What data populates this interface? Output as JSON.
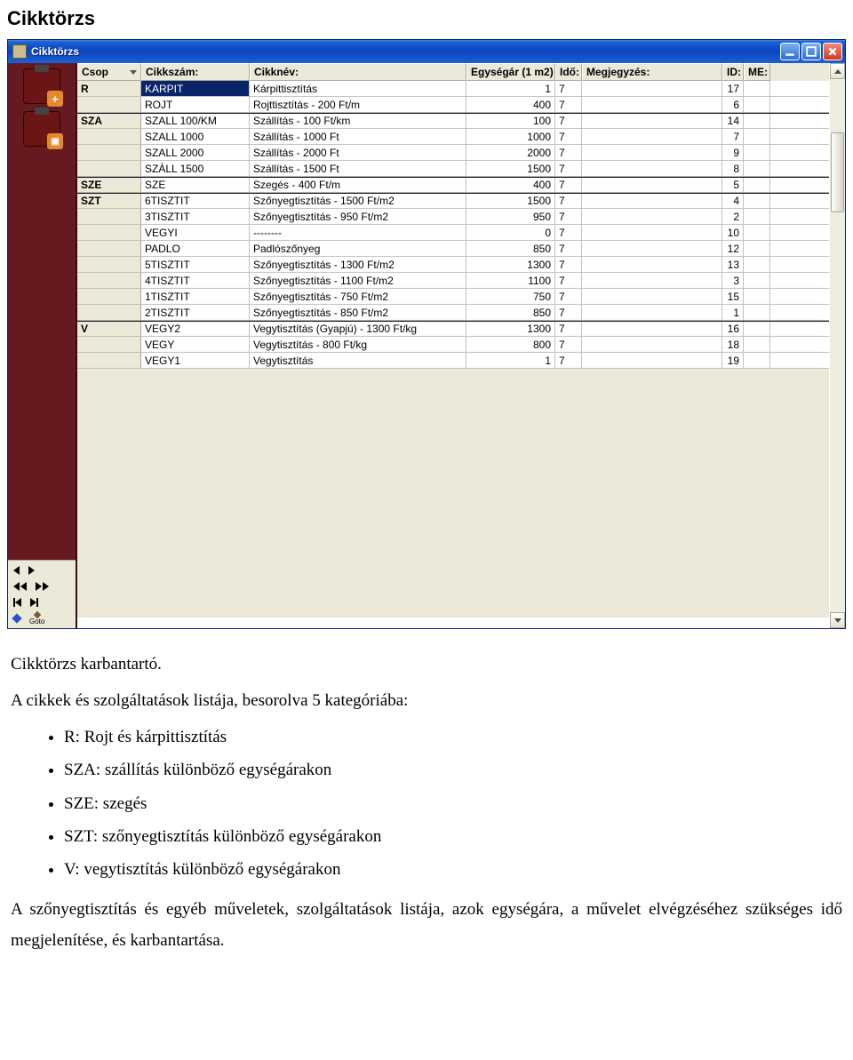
{
  "page_heading": "Cikktörzs",
  "window": {
    "title": "Cikktörzs",
    "columns": {
      "csop": "Csop",
      "cikkszam": "Cikkszám:",
      "cikknev": "Cikknév:",
      "egysegar": "Egységár (1 m2)",
      "ido": "Idő:",
      "megjegyzes": "Megjegyzés:",
      "id": "ID:",
      "me": "ME:"
    },
    "rows": [
      {
        "csop": "R",
        "sep": false,
        "szam": "KARPIT",
        "nev": "Kárpittisztítás",
        "ar": "1",
        "ido": "7",
        "megj": "",
        "id": "17",
        "me": "",
        "hl": true
      },
      {
        "csop": "",
        "sep": false,
        "szam": "ROJT",
        "nev": "Rojttisztítás - 200 Ft/m",
        "ar": "400",
        "ido": "7",
        "megj": "",
        "id": "6",
        "me": ""
      },
      {
        "csop": "SZA",
        "sep": true,
        "szam": "SZALL 100/KM",
        "nev": "Szállítás - 100 Ft/km",
        "ar": "100",
        "ido": "7",
        "megj": "",
        "id": "14",
        "me": ""
      },
      {
        "csop": "",
        "sep": false,
        "szam": "SZALL 1000",
        "nev": "Szállítás - 1000 Ft",
        "ar": "1000",
        "ido": "7",
        "megj": "",
        "id": "7",
        "me": ""
      },
      {
        "csop": "",
        "sep": false,
        "szam": "SZALL 2000",
        "nev": "Szállítás - 2000 Ft",
        "ar": "2000",
        "ido": "7",
        "megj": "",
        "id": "9",
        "me": ""
      },
      {
        "csop": "",
        "sep": false,
        "szam": "SZÁLL 1500",
        "nev": "Szállítás - 1500 Ft",
        "ar": "1500",
        "ido": "7",
        "megj": "",
        "id": "8",
        "me": ""
      },
      {
        "csop": "SZE",
        "sep": true,
        "szam": "SZE",
        "nev": "Szegés - 400 Ft/m",
        "ar": "400",
        "ido": "7",
        "megj": "",
        "id": "5",
        "me": ""
      },
      {
        "csop": "SZT",
        "sep": true,
        "szam": "6TISZTIT",
        "nev": "Szőnyegtisztítás - 1500 Ft/m2",
        "ar": "1500",
        "ido": "7",
        "megj": "",
        "id": "4",
        "me": ""
      },
      {
        "csop": "",
        "sep": false,
        "szam": "3TISZTIT",
        "nev": "Szőnyegtisztítás - 950 Ft/m2",
        "ar": "950",
        "ido": "7",
        "megj": "",
        "id": "2",
        "me": ""
      },
      {
        "csop": "",
        "sep": false,
        "szam": "VEGYI",
        "nev": "--------",
        "ar": "0",
        "ido": "7",
        "megj": "",
        "id": "10",
        "me": ""
      },
      {
        "csop": "",
        "sep": false,
        "szam": "PADLO",
        "nev": "Padlószőnyeg",
        "ar": "850",
        "ido": "7",
        "megj": "",
        "id": "12",
        "me": ""
      },
      {
        "csop": "",
        "sep": false,
        "szam": "5TISZTIT",
        "nev": "Szőnyegtisztítás - 1300 Ft/m2",
        "ar": "1300",
        "ido": "7",
        "megj": "",
        "id": "13",
        "me": ""
      },
      {
        "csop": "",
        "sep": false,
        "szam": "4TISZTIT",
        "nev": "Szőnyegtisztítás - 1100 Ft/m2",
        "ar": "1100",
        "ido": "7",
        "megj": "",
        "id": "3",
        "me": ""
      },
      {
        "csop": "",
        "sep": false,
        "szam": "1TISZTIT",
        "nev": "Szőnyegtisztítás - 750 Ft/m2",
        "ar": "750",
        "ido": "7",
        "megj": "",
        "id": "15",
        "me": ""
      },
      {
        "csop": "",
        "sep": false,
        "szam": "2TISZTIT",
        "nev": "Szőnyegtisztítás - 850 Ft/m2",
        "ar": "850",
        "ido": "7",
        "megj": "",
        "id": "1",
        "me": ""
      },
      {
        "csop": "V",
        "sep": true,
        "szam": "VEGY2",
        "nev": "Vegytisztítás (Gyapjú) - 1300 Ft/kg",
        "ar": "1300",
        "ido": "7",
        "megj": "",
        "id": "16",
        "me": ""
      },
      {
        "csop": "",
        "sep": false,
        "szam": "VEGY",
        "nev": "Vegytisztítás - 800 Ft/kg",
        "ar": "800",
        "ido": "7",
        "megj": "",
        "id": "18",
        "me": ""
      },
      {
        "csop": "",
        "sep": false,
        "szam": "VEGY1",
        "nev": "Vegytisztítás",
        "ar": "1",
        "ido": "7",
        "megj": "",
        "id": "19",
        "me": ""
      }
    ],
    "nav": {
      "goto": "Goto"
    }
  },
  "doc": {
    "intro": "Cikktörzs karbantartó.",
    "list_intro": "A cikkek és szolgáltatások listája, besorolva 5 kategóriába:",
    "bullets": [
      "R: Rojt és kárpittisztítás",
      "SZA: szállítás különböző egységárakon",
      "SZE: szegés",
      "SZT: szőnyegtisztítás különböző egységárakon",
      "V: vegytisztítás különböző egységárakon"
    ],
    "footer": "A szőnyegtisztítás és egyéb műveletek, szolgáltatások listája, azok egységára, a művelet elvégzéséhez szükséges idő megjelenítése, és karbantartása."
  }
}
